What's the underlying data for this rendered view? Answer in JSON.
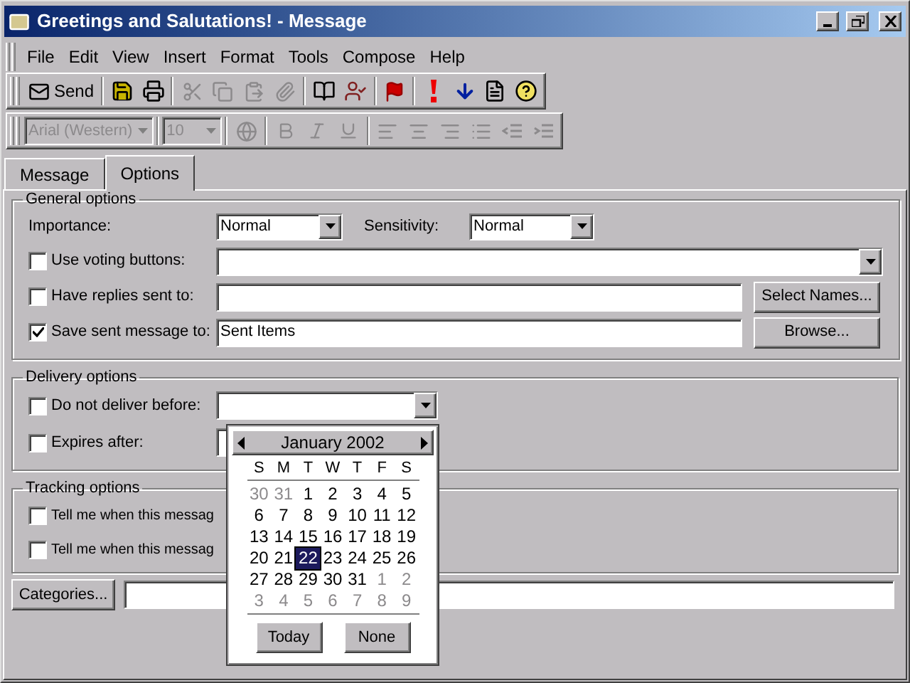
{
  "window": {
    "title": "Greetings and Salutations! - Message"
  },
  "menu": [
    "File",
    "Edit",
    "View",
    "Insert",
    "Format",
    "Tools",
    "Compose",
    "Help"
  ],
  "standard_toolbar": {
    "send_label": "Send"
  },
  "formatting_toolbar": {
    "disabled": true,
    "font": "Arial (Western)",
    "size": "10"
  },
  "tabs": [
    {
      "label": "Message",
      "selected": false
    },
    {
      "label": "Options",
      "selected": true
    }
  ],
  "general_options": {
    "title": "General options",
    "importance": {
      "label": "Importance:",
      "value": "Normal"
    },
    "sensitivity": {
      "label": "Sensitivity:",
      "value": "Normal"
    },
    "voting": {
      "label": "Use voting buttons:",
      "checked": false
    },
    "replies": {
      "label": "Have replies sent to:",
      "checked": false,
      "button": "Select Names..."
    },
    "save_sent": {
      "label": "Save sent message to:",
      "checked": true,
      "value": "Sent Items",
      "button": "Browse..."
    }
  },
  "delivery_options": {
    "title": "Delivery options",
    "rows": [
      {
        "label": "Do not deliver before:",
        "checked": false
      },
      {
        "label": "Expires after:",
        "checked": false
      }
    ]
  },
  "tracking_options": {
    "title": "Tracking options",
    "rows": [
      {
        "label": "Tell me when this messag",
        "checked": false
      },
      {
        "label": "Tell me when this messag",
        "checked": false
      }
    ]
  },
  "categories_button": "Categories...",
  "calendar": {
    "month": "January 2002",
    "weekdays": [
      "S",
      "M",
      "T",
      "W",
      "T",
      "F",
      "S"
    ],
    "weeks": [
      [
        {
          "label": "30",
          "in_month": false,
          "selected": false
        },
        {
          "label": "31",
          "in_month": false,
          "selected": false
        },
        {
          "label": "1",
          "in_month": true,
          "selected": false
        },
        {
          "label": "2",
          "in_month": true,
          "selected": false
        },
        {
          "label": "3",
          "in_month": true,
          "selected": false
        },
        {
          "label": "4",
          "in_month": true,
          "selected": false
        },
        {
          "label": "5",
          "in_month": true,
          "selected": false
        }
      ],
      [
        {
          "label": "6",
          "in_month": true,
          "selected": false
        },
        {
          "label": "7",
          "in_month": true,
          "selected": false
        },
        {
          "label": "8",
          "in_month": true,
          "selected": false
        },
        {
          "label": "9",
          "in_month": true,
          "selected": false
        },
        {
          "label": "10",
          "in_month": true,
          "selected": false
        },
        {
          "label": "11",
          "in_month": true,
          "selected": false
        },
        {
          "label": "12",
          "in_month": true,
          "selected": false
        }
      ],
      [
        {
          "label": "13",
          "in_month": true,
          "selected": false
        },
        {
          "label": "14",
          "in_month": true,
          "selected": false
        },
        {
          "label": "15",
          "in_month": true,
          "selected": false
        },
        {
          "label": "16",
          "in_month": true,
          "selected": false
        },
        {
          "label": "17",
          "in_month": true,
          "selected": false
        },
        {
          "label": "18",
          "in_month": true,
          "selected": false
        },
        {
          "label": "19",
          "in_month": true,
          "selected": false
        }
      ],
      [
        {
          "label": "20",
          "in_month": true,
          "selected": false
        },
        {
          "label": "21",
          "in_month": true,
          "selected": false
        },
        {
          "label": "22",
          "in_month": true,
          "selected": true
        },
        {
          "label": "23",
          "in_month": true,
          "selected": false
        },
        {
          "label": "24",
          "in_month": true,
          "selected": false
        },
        {
          "label": "25",
          "in_month": true,
          "selected": false
        },
        {
          "label": "26",
          "in_month": true,
          "selected": false
        }
      ],
      [
        {
          "label": "27",
          "in_month": true,
          "selected": false
        },
        {
          "label": "28",
          "in_month": true,
          "selected": false
        },
        {
          "label": "29",
          "in_month": true,
          "selected": false
        },
        {
          "label": "30",
          "in_month": true,
          "selected": false
        },
        {
          "label": "31",
          "in_month": true,
          "selected": false
        },
        {
          "label": "1",
          "in_month": false,
          "selected": false
        },
        {
          "label": "2",
          "in_month": false,
          "selected": false
        }
      ],
      [
        {
          "label": "3",
          "in_month": false,
          "selected": false
        },
        {
          "label": "4",
          "in_month": false,
          "selected": false
        },
        {
          "label": "5",
          "in_month": false,
          "selected": false
        },
        {
          "label": "6",
          "in_month": false,
          "selected": false
        },
        {
          "label": "7",
          "in_month": false,
          "selected": false
        },
        {
          "label": "8",
          "in_month": false,
          "selected": false
        },
        {
          "label": "9",
          "in_month": false,
          "selected": false
        }
      ]
    ],
    "buttons": [
      "Today",
      "None"
    ]
  }
}
